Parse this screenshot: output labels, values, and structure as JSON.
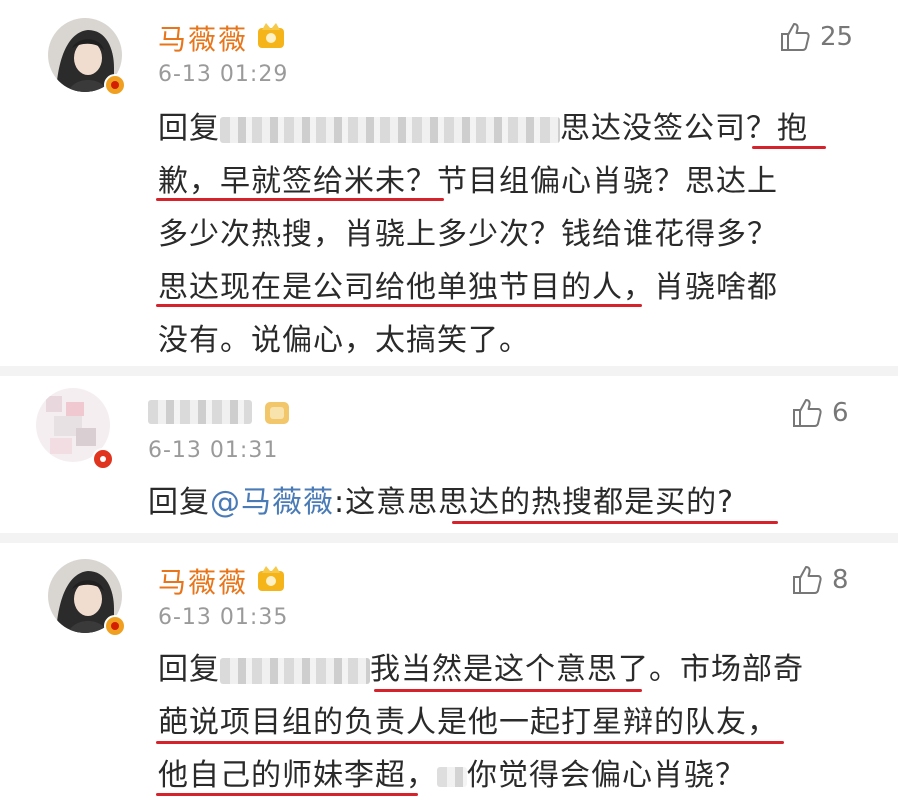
{
  "colors": {
    "username": "#e8751a",
    "time": "#9a9a9a",
    "mention": "#4a7bb7",
    "underline": "#d6222b",
    "separator": "#f3f3f3"
  },
  "comments": [
    {
      "username": "马薇薇",
      "time": "6-13 01:29",
      "likes": "25",
      "like_icon": "thumbs-up-icon",
      "lines": [
        {
          "pre": "回复",
          "post": "思达没签公司？抱"
        },
        {
          "text": "歉，早就签给米未？节目组偏心肖骁？思达上"
        },
        {
          "text": "多少次热搜，肖骁上多少次？钱给谁花得多？"
        },
        {
          "text": "思达现在是公司给他单独节目的人，肖骁啥都"
        },
        {
          "text": "没有。说偏心，太搞笑了。"
        }
      ]
    },
    {
      "username": "",
      "time": "6-13 01:31",
      "likes": "6",
      "like_icon": "thumbs-up-icon",
      "lines": [
        {
          "pre": "回复",
          "mention": "@马薇薇",
          "post": ":这意思思达的热搜都是买的?"
        }
      ]
    },
    {
      "username": "马薇薇",
      "time": "6-13 01:35",
      "likes": "8",
      "like_icon": "thumbs-up-icon",
      "lines": [
        {
          "pre": "回复",
          "post": "我当然是这个意思了。市场部奇"
        },
        {
          "text": "葩说项目组的负责人是他一起打星辩的队友，"
        },
        {
          "pre": "他自己的师妹李超，",
          "post": "你觉得会偏心肖骁？"
        }
      ]
    }
  ]
}
